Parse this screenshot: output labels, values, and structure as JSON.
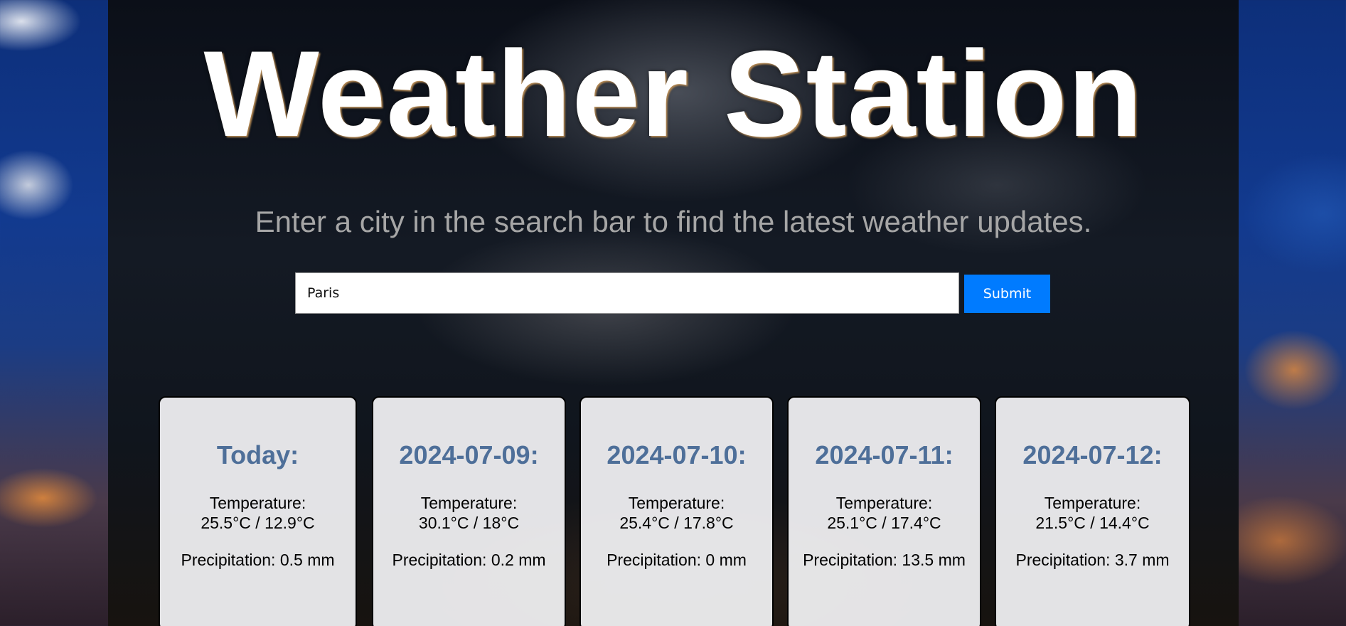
{
  "header": {
    "title": "Weather Station",
    "subtitle": "Enter a city in the search bar to find the latest weather updates."
  },
  "search": {
    "value": "Paris",
    "placeholder": "",
    "submit_label": "Submit"
  },
  "colors": {
    "accent": "#007bff",
    "card_title": "#4e6f99",
    "subtitle": "#a6a6a6"
  },
  "forecast": [
    {
      "date": "Today:",
      "temp_label": "Temperature:",
      "temp": "25.5°C / 12.9°C",
      "precip": "Precipitation: 0.5 mm"
    },
    {
      "date": "2024-07-09:",
      "temp_label": "Temperature:",
      "temp": "30.1°C / 18°C",
      "precip": "Precipitation: 0.2 mm"
    },
    {
      "date": "2024-07-10:",
      "temp_label": "Temperature:",
      "temp": "25.4°C / 17.8°C",
      "precip": "Precipitation: 0 mm"
    },
    {
      "date": "2024-07-11:",
      "temp_label": "Temperature:",
      "temp": "25.1°C / 17.4°C",
      "precip": "Precipitation: 13.5 mm"
    },
    {
      "date": "2024-07-12:",
      "temp_label": "Temperature:",
      "temp": "21.5°C / 14.4°C",
      "precip": "Precipitation: 3.7 mm"
    }
  ]
}
